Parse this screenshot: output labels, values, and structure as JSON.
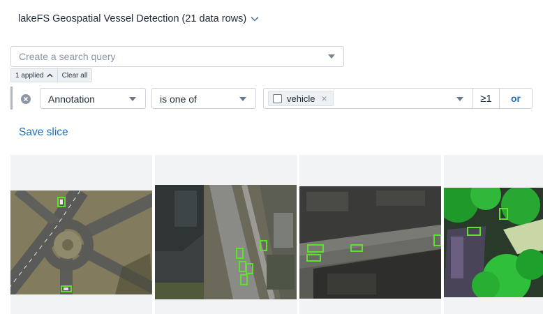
{
  "dataset": {
    "title": "lakeFS Geospatial Vessel Detection (21 data rows)"
  },
  "search": {
    "placeholder": "Create a search query",
    "value": ""
  },
  "filter_summary": {
    "applied_label": "1 applied",
    "clear_label": "Clear all"
  },
  "filter": {
    "field": "Annotation",
    "operator": "is one of",
    "values": [
      {
        "label": "vehicle",
        "checked": false
      }
    ],
    "count": "≥1",
    "or_label": "or"
  },
  "save_slice_label": "Save slice",
  "gallery": {
    "box_color": "#5ee02e",
    "items": [
      {
        "name": "thumbnail-roundabout",
        "scene": "roundabout"
      },
      {
        "name": "thumbnail-street-buildings",
        "scene": "street"
      },
      {
        "name": "thumbnail-rooftops",
        "scene": "rooftops"
      },
      {
        "name": "thumbnail-vegetation",
        "scene": "vegetation"
      }
    ]
  }
}
